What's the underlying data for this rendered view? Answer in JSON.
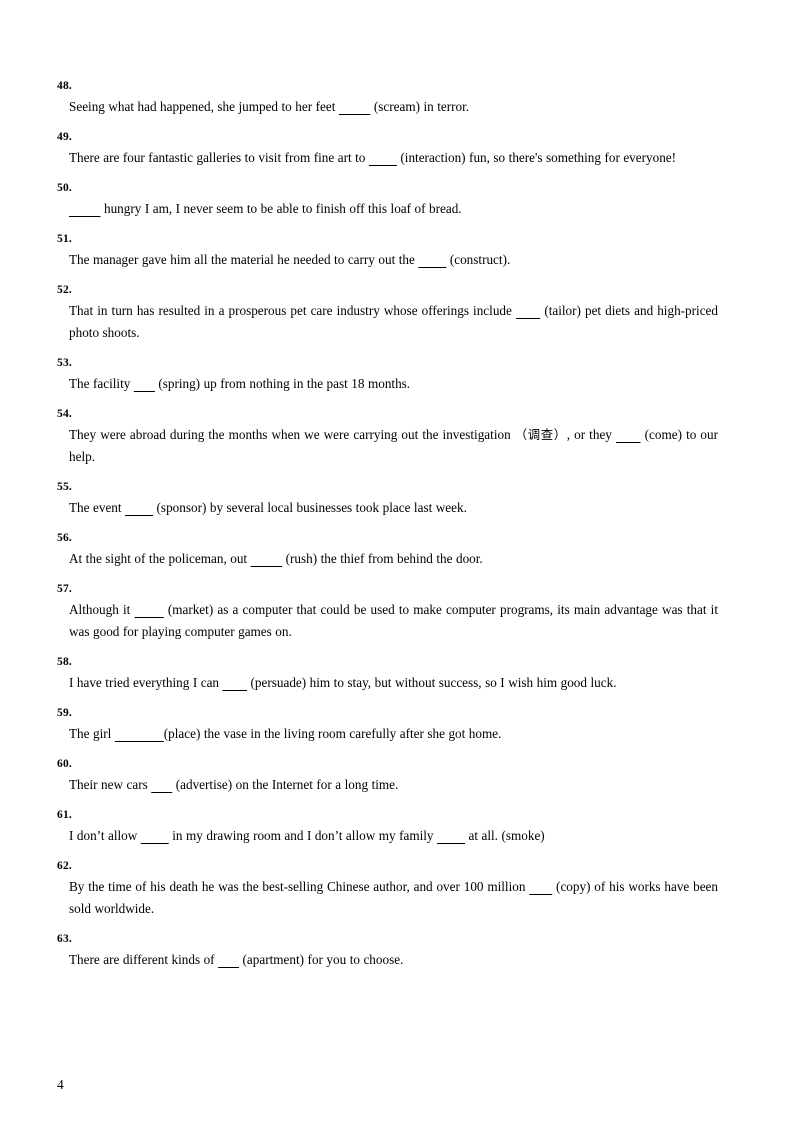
{
  "document": {
    "page_number": "4",
    "items": [
      {
        "number": "48.",
        "segments": [
          {
            "type": "text",
            "value": "Seeing what had happened, she jumped to her feet "
          },
          {
            "type": "blank",
            "value": "         "
          },
          {
            "type": "text",
            "value": "  (scream) in terror."
          }
        ],
        "full_text": "Seeing what had happened, she jumped to her feet ________  (scream) in terror.",
        "cue": "scream"
      },
      {
        "number": "49.",
        "segments": [
          {
            "type": "text",
            "value": "There are four fantastic galleries to visit from fine art to "
          },
          {
            "type": "blank",
            "value": "        "
          },
          {
            "type": "text",
            "value": "  (interaction) fun, so there's something for everyone!"
          }
        ],
        "full_text": "There are four fantastic galleries to visit from fine art to ________  (interaction) fun, so there's something for everyone!",
        "cue": "interaction"
      },
      {
        "number": "50.",
        "segments": [
          {
            "type": "blank",
            "value": "         "
          },
          {
            "type": "text",
            "value": " hungry I am, I never seem to be able to finish off this loaf of bread."
          }
        ],
        "full_text": "_________ hungry I am, I never seem to be able to finish off this loaf of bread.",
        "cue": ""
      },
      {
        "number": "51.",
        "segments": [
          {
            "type": "text",
            "value": "The manager gave him all the material he needed to carry out the "
          },
          {
            "type": "blank",
            "value": "        "
          },
          {
            "type": "text",
            "value": "  (construct)."
          }
        ],
        "full_text": "The manager gave him all the material he needed to carry out the ________  (construct).",
        "cue": "construct"
      },
      {
        "number": "52.",
        "segments": [
          {
            "type": "text",
            "value": "That in turn has resulted in a prosperous pet care industry whose offerings include "
          },
          {
            "type": "blank",
            "value": "      "
          },
          {
            "type": "text",
            "value": "  (tailor) pet diets and high-priced photo shoots."
          }
        ],
        "full_text": "That in turn has resulted in a prosperous pet care industry whose offerings include ______  (tailor) pet diets and high-priced photo shoots.",
        "cue": "tailor"
      },
      {
        "number": "53.",
        "segments": [
          {
            "type": "text",
            "value": "The facility "
          },
          {
            "type": "blank",
            "value": "      "
          },
          {
            "type": "text",
            "value": "  (spring)  up from nothing in the past 18 months."
          }
        ],
        "full_text": "The facility ______  (spring)  up from nothing in the past 18 months.",
        "cue": "spring"
      },
      {
        "number": "54.",
        "segments": [
          {
            "type": "text",
            "value": "They were abroad during the months when we were carrying out the investigation "
          },
          {
            "type": "cjk",
            "value": "（调查）"
          },
          {
            "type": "text",
            "value": ", or they "
          },
          {
            "type": "blank",
            "value": "      "
          },
          {
            "type": "text",
            "value": "  (come) to our help."
          }
        ],
        "full_text": "They were abroad during the months when we were carrying out the investigation （调查）, or they ______  (come) to our help.",
        "cue": "come",
        "gloss": "调查"
      },
      {
        "number": "55.",
        "segments": [
          {
            "type": "text",
            "value": "The event "
          },
          {
            "type": "blank",
            "value": "        "
          },
          {
            "type": "text",
            "value": "  (sponsor) by several local businesses took place last week."
          }
        ],
        "full_text": "The event ________  (sponsor) by several local businesses took place last week.",
        "cue": "sponsor"
      },
      {
        "number": "56.",
        "segments": [
          {
            "type": "text",
            "value": "At the sight of the policeman, out "
          },
          {
            "type": "blank",
            "value": "         "
          },
          {
            "type": "text",
            "value": " (rush) the thief from behind the door."
          }
        ],
        "full_text": "At the sight of the policeman, out _________ (rush) the thief from behind the door.",
        "cue": "rush"
      },
      {
        "number": "57.",
        "segments": [
          {
            "type": "text",
            "value": "Although it "
          },
          {
            "type": "blank",
            "value": "       "
          },
          {
            "type": "text",
            "value": "  (market) as a computer that could be used to make computer programs, its main advantage was that it was good for playing computer games on."
          }
        ],
        "full_text": "Although it _______  (market) as a computer that could be used to make computer programs, its main advantage was that it was good for playing computer games on.",
        "cue": "market"
      },
      {
        "number": "58.",
        "segments": [
          {
            "type": "text",
            "value": "I have tried everything I can "
          },
          {
            "type": "blank",
            "value": "       "
          },
          {
            "type": "text",
            "value": "  (persuade) him to stay, but without success, so I wish him good luck."
          }
        ],
        "full_text": "I have tried everything I can _______  (persuade) him to stay, but without success, so I wish him good luck.",
        "cue": "persuade"
      },
      {
        "number": "59.",
        "segments": [
          {
            "type": "text",
            "value": "The girl "
          },
          {
            "type": "blank",
            "value": "              "
          },
          {
            "type": "text",
            "value": "(place) the vase in the living room carefully after she got home."
          }
        ],
        "full_text": "The girl _____________(place) the vase in the living room carefully after she got home.",
        "cue": "place"
      },
      {
        "number": "60.",
        "segments": [
          {
            "type": "text",
            "value": "Their new cars "
          },
          {
            "type": "blank",
            "value": "      "
          },
          {
            "type": "text",
            "value": "  (advertise) on the Internet for a long time."
          }
        ],
        "full_text": "Their new cars ______  (advertise) on the Internet for a long time.",
        "cue": "advertise"
      },
      {
        "number": "61.",
        "segments": [
          {
            "type": "text",
            "value": "I don’t allow "
          },
          {
            "type": "blank",
            "value": "        "
          },
          {
            "type": "text",
            "value": " in my drawing room and I don’t allow my family "
          },
          {
            "type": "blank",
            "value": "        "
          },
          {
            "type": "text",
            "value": " at all.  (smoke)"
          }
        ],
        "full_text": "I don’t allow ________ in my drawing room and I don’t allow my family ________ at all.  (smoke)",
        "cue": "smoke"
      },
      {
        "number": "62.",
        "segments": [
          {
            "type": "text",
            "value": "By the time of his death he was the best-selling Chinese author, and over 100 million "
          },
          {
            "type": "blank",
            "value": "      "
          },
          {
            "type": "text",
            "value": "  (copy) of his works have been sold worldwide."
          }
        ],
        "full_text": "By the time of his death he was the best-selling Chinese author, and over 100 million ______  (copy) of his works have been sold worldwide.",
        "cue": "copy"
      },
      {
        "number": "63.",
        "segments": [
          {
            "type": "text",
            "value": "There are different kinds of "
          },
          {
            "type": "blank",
            "value": "      "
          },
          {
            "type": "text",
            "value": "  (apartment) for you to choose."
          }
        ],
        "full_text": "There are different kinds of ______  (apartment) for you to choose.",
        "cue": "apartment"
      }
    ]
  }
}
